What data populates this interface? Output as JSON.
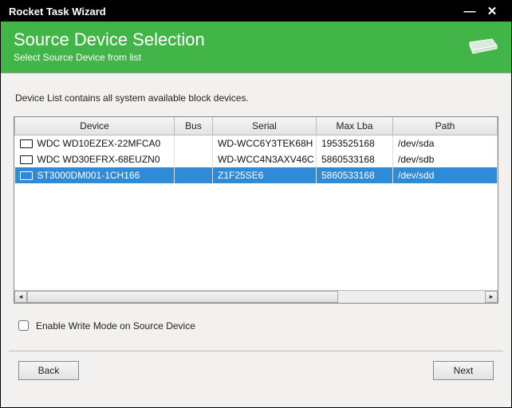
{
  "window": {
    "title": "Rocket Task Wizard"
  },
  "header": {
    "title": "Source Device Selection",
    "subtitle": "Select Source Device from list"
  },
  "description": "Device List contains all system available block devices.",
  "columns": {
    "device": "Device",
    "bus": "Bus",
    "serial": "Serial",
    "maxlba": "Max Lba",
    "path": "Path"
  },
  "rows": [
    {
      "device": "WDC WD10EZEX-22MFCA0",
      "bus": "",
      "serial": "WD-WCC6Y3TEK68H",
      "maxlba": "1953525168",
      "path": "/dev/sda",
      "selected": false
    },
    {
      "device": "WDC WD30EFRX-68EUZN0",
      "bus": "",
      "serial": "WD-WCC4N3AXV46C",
      "maxlba": "5860533168",
      "path": "/dev/sdb",
      "selected": false
    },
    {
      "device": "ST3000DM001-1CH166",
      "bus": "",
      "serial": "Z1F25SE6",
      "maxlba": "5860533168",
      "path": "/dev/sdd",
      "selected": true
    }
  ],
  "checkbox": {
    "label": "Enable Write Mode on Source Device",
    "checked": false
  },
  "buttons": {
    "back": "Back",
    "next": "Next"
  }
}
